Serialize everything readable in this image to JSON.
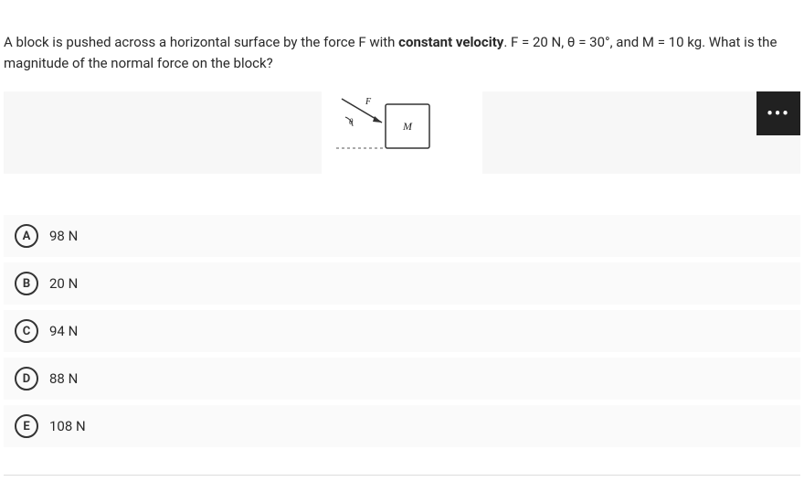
{
  "question": {
    "prefix": "A block is pushed across a horizontal surface by the force F with ",
    "bold": "constant velocity",
    "suffix": ". F = 20 N, θ = 30°, and M = 10 kg. What is the magnitude of the normal force on the block?"
  },
  "diagram": {
    "force_label": "F",
    "angle_label": "θ",
    "mass_label": "M"
  },
  "options": [
    {
      "letter": "A",
      "text": "98 N"
    },
    {
      "letter": "B",
      "text": "20 N"
    },
    {
      "letter": "C",
      "text": "94 N"
    },
    {
      "letter": "D",
      "text": "88 N"
    },
    {
      "letter": "E",
      "text": "108 N"
    }
  ],
  "more_label": "•••"
}
